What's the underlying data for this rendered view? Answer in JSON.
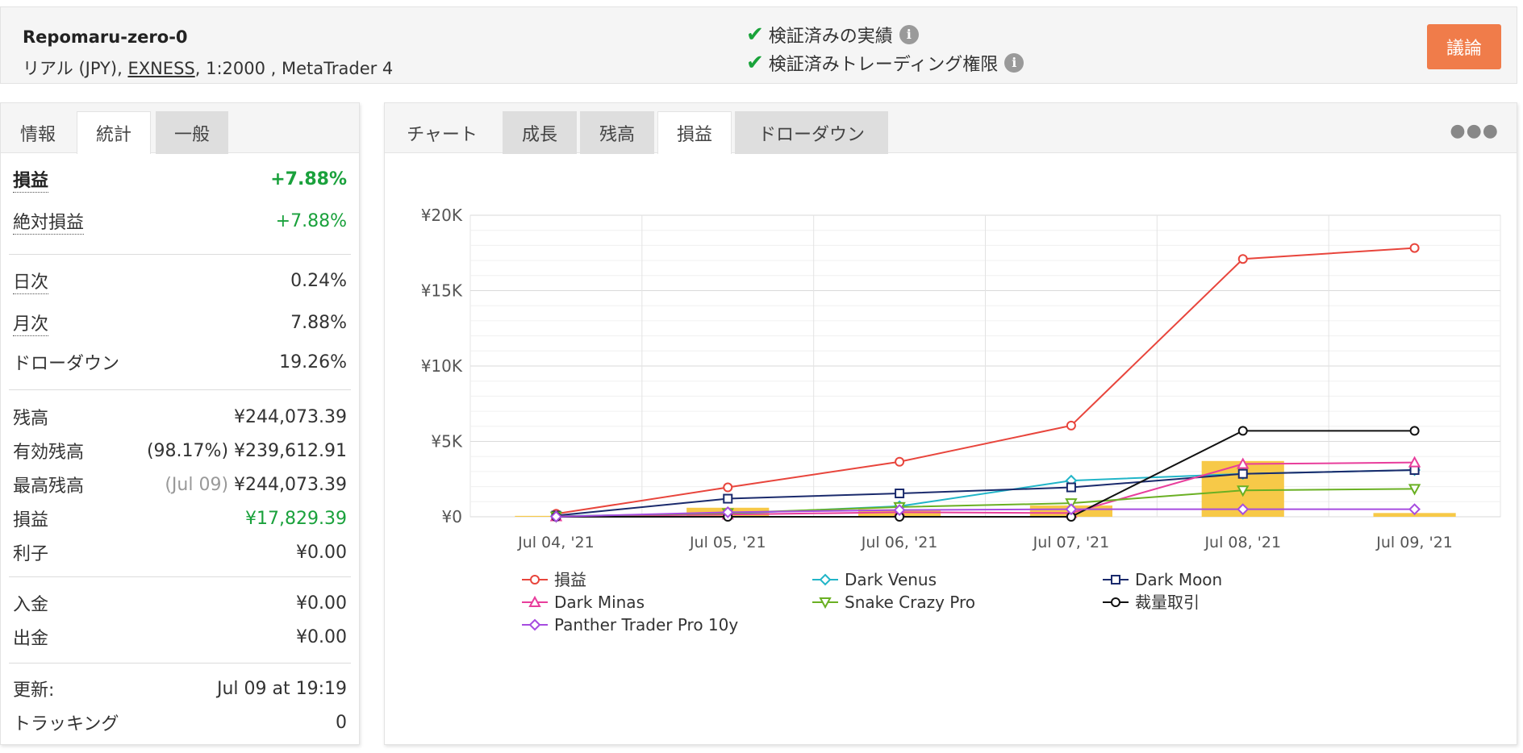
{
  "header": {
    "account_name": "Repomaru-zero-0",
    "account_type": "リアル (JPY), ",
    "broker": "EXNESS",
    "account_rest": ", 1:2000 , MetaTrader 4",
    "verified_track": "検証済みの実績",
    "verified_privileges": "検証済みトレーディング権限",
    "discuss_label": "議論"
  },
  "left_tabs": [
    {
      "label": "情報",
      "active": false
    },
    {
      "label": "統計",
      "active": true
    },
    {
      "label": "一般",
      "active": false
    }
  ],
  "stats": {
    "gain_label": "損益",
    "gain_value": "+7.88%",
    "abs_gain_label": "絶対損益",
    "abs_gain_value": "+7.88%",
    "daily_label": "日次",
    "daily_value": "0.24%",
    "monthly_label": "月次",
    "monthly_value": "7.88%",
    "drawdown_label": "ドローダウン",
    "drawdown_value": "19.26%",
    "balance_label": "残高",
    "balance_value": "¥244,073.39",
    "equity_label": "有効残高",
    "equity_pct": "(98.17%)",
    "equity_value": "¥239,612.91",
    "highest_label": "最高残高",
    "highest_date": "(Jul 09)",
    "highest_value": "¥244,073.39",
    "profit_label": "損益",
    "profit_value": "¥17,829.39",
    "interest_label": "利子",
    "interest_value": "¥0.00",
    "deposits_label": "入金",
    "deposits_value": "¥0.00",
    "withdrawals_label": "出金",
    "withdrawals_value": "¥0.00",
    "updated_label": "更新:",
    "updated_value": "Jul 09 at 19:19",
    "tracking_label": "トラッキング",
    "tracking_value": "0"
  },
  "chart_tabs": [
    {
      "label": "チャート",
      "active": false
    },
    {
      "label": "成長",
      "active": false
    },
    {
      "label": "残高",
      "active": false
    },
    {
      "label": "損益",
      "active": true
    },
    {
      "label": "ドローダウン",
      "active": false
    }
  ],
  "more_icon": "more-dots-icon",
  "chart_data": {
    "type": "line",
    "categories": [
      "Jul 04, '21",
      "Jul 05, '21",
      "Jul 06, '21",
      "Jul 07, '21",
      "Jul 08, '21",
      "Jul 09, '21"
    ],
    "y_ticks": [
      "¥0",
      "¥5K",
      "¥10K",
      "¥15K",
      "¥20K"
    ],
    "ylim": [
      0,
      20000
    ],
    "grid": true,
    "legend_position": "bottom",
    "bars": {
      "color": "#f7c948",
      "values": [
        60,
        600,
        500,
        750,
        3700,
        250
      ]
    },
    "series": [
      {
        "name": "損益",
        "color": "#e8453c",
        "marker": "circle",
        "values": [
          200,
          1950,
          3650,
          6050,
          17100,
          17829
        ]
      },
      {
        "name": "Dark Venus",
        "color": "#21b5c8",
        "marker": "diamond",
        "values": [
          50,
          200,
          700,
          2400,
          2850,
          3100
        ]
      },
      {
        "name": "Dark Moon",
        "color": "#1a2a6c",
        "marker": "square",
        "values": [
          80,
          1200,
          1550,
          1950,
          2850,
          3100
        ]
      },
      {
        "name": "Dark Minas",
        "color": "#e83e9c",
        "marker": "triangle",
        "values": [
          30,
          150,
          300,
          250,
          3500,
          3600
        ]
      },
      {
        "name": "Snake Crazy Pro",
        "color": "#6ab023",
        "marker": "triangle-down",
        "values": [
          20,
          250,
          650,
          900,
          1750,
          1850
        ]
      },
      {
        "name": "裁量取引",
        "color": "#111111",
        "marker": "circle",
        "values": [
          0,
          0,
          0,
          0,
          5700,
          5700
        ]
      },
      {
        "name": "Panther Trader Pro 10y",
        "color": "#a64ce0",
        "marker": "diamond",
        "values": [
          10,
          300,
          450,
          500,
          500,
          500
        ]
      }
    ]
  }
}
